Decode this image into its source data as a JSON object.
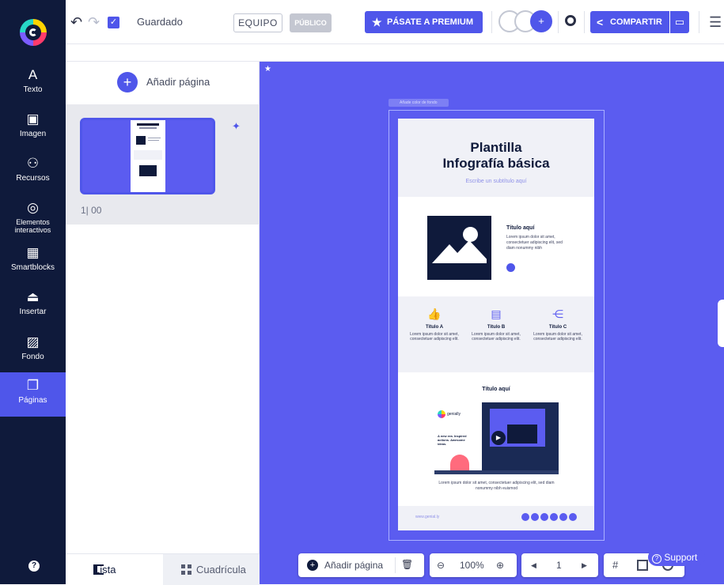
{
  "nav": {
    "items": [
      {
        "icon": "text-icon",
        "glyph": "A",
        "label": "Texto"
      },
      {
        "icon": "image-icon",
        "glyph": "▣",
        "label": "Imagen"
      },
      {
        "icon": "resources-icon",
        "glyph": "⚇",
        "label": "Recursos"
      },
      {
        "icon": "interactive-icon",
        "glyph": "◎",
        "label": "Elementos interactivos"
      },
      {
        "icon": "smartblocks-icon",
        "glyph": "▦",
        "label": "Smartblocks"
      },
      {
        "icon": "insert-icon",
        "glyph": "⏏",
        "label": "Insertar"
      },
      {
        "icon": "background-icon",
        "glyph": "▨",
        "label": "Fondo"
      },
      {
        "icon": "pages-icon",
        "glyph": "❐",
        "label": "Páginas"
      }
    ],
    "help_glyph": "?"
  },
  "topbar": {
    "undo_glyph": "↶",
    "redo_glyph": "↷",
    "save_check": "✓",
    "save_label": "Guardado",
    "team_label": "EQUIPO",
    "public_label": "PÚBLICO",
    "premium_label": "PÁSATE A PREMIUM",
    "premium_icon": "★",
    "share_label": "COMPARTIR",
    "share_icon": "<",
    "present_icon": "▭",
    "menu_glyph": "☰",
    "add_collab": "+"
  },
  "pages_panel": {
    "add_page_label": "Añadir página",
    "add_glyph": "+",
    "page_number": "1| 00",
    "magic_glyph": "✦",
    "tab_list": "Lista",
    "tab_grid": "Cuadrícula"
  },
  "document": {
    "selection_tag": "Añade color de fondo",
    "title_line1": "Plantilla",
    "title_line2": "Infografía básica",
    "subtitle": "Escribe un subtítulo aquí",
    "block1": {
      "title": "Título aquí",
      "text": "Lorem ipsum dolor sit amet, consectetuer adipiscing elit, sed diam nonummy nibh"
    },
    "columns": [
      {
        "icon": "thumbs-up-icon",
        "glyph": "👍",
        "title": "Título A",
        "text": "Lorem ipsum dolor sit amet, consectetuer adipiscing elit."
      },
      {
        "icon": "chart-icon",
        "glyph": "▤",
        "title": "Título B",
        "text": "Lorem ipsum dolor sit amet, consectetuer adipiscing elit."
      },
      {
        "icon": "share-nodes-icon",
        "glyph": "⋲",
        "title": "Título C",
        "text": "Lorem ipsum dolor sit amet, consectetuer adipiscing elit."
      }
    ],
    "block3_title": "Título aquí",
    "video": {
      "brand": "genially",
      "tagline": "A new era. Inspired actions. Awesome ideas.",
      "play": "▶"
    },
    "block3_text": "Lorem ipsum dolor sit amet, consectetuer adipiscing elit, sed diam nonummy nibh euismod",
    "footer_url": "www.genial.ly"
  },
  "bottom_toolbar": {
    "add_page_label": "Añadir página",
    "add_glyph": "+",
    "trash_glyph": "🗑",
    "zoom_out": "⊖",
    "zoom_level": "100%",
    "zoom_in": "⊕",
    "prev": "◀",
    "page": "1",
    "next": "▶",
    "grid_glyph": "#",
    "support_label": "Support",
    "support_glyph": "?"
  },
  "colors": {
    "nav_bg": "#0f1a3b",
    "accent": "#4f56ea",
    "canvas": "#5b5cf0"
  }
}
